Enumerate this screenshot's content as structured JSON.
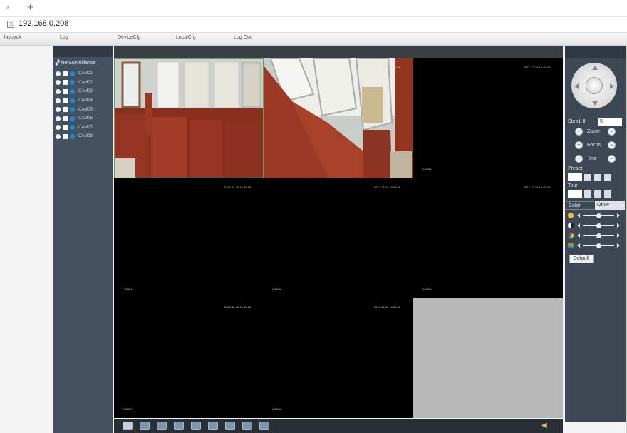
{
  "browser": {
    "tab_close": "×",
    "tab_new": "+",
    "url": "192.168.0.208"
  },
  "nav": {
    "items": [
      "layback",
      "Log",
      "DeviceCfg",
      "LocalCfg",
      "Log Out"
    ]
  },
  "sidebar": {
    "root": "NetSurveillance",
    "cameras": [
      "CAM01",
      "CAM02",
      "CAM03",
      "CAM04",
      "CAM05",
      "CAM06",
      "CAM07",
      "CAM08"
    ]
  },
  "video": {
    "cells": [
      {
        "timestamp": "",
        "channel": ""
      },
      {
        "timestamp": "2017-12-16 15:40:38",
        "channel": ""
      },
      {
        "timestamp": "2017-12-16 15:40:38",
        "channel": "CAM03"
      },
      {
        "timestamp": "2017-12-16 15:40:38",
        "channel": "CAM04"
      },
      {
        "timestamp": "2017-12-16 15:40:38",
        "channel": "CAM05"
      },
      {
        "timestamp": "2017-12-16 15:40:38",
        "channel": "CAM06"
      },
      {
        "timestamp": "2017-12-16 15:40:38",
        "channel": "CAM07"
      },
      {
        "timestamp": "2017-12-16 15:40:38",
        "channel": "CAM08"
      },
      {
        "timestamp": "",
        "channel": ""
      }
    ]
  },
  "ptz": {
    "step_label": "Step1-8:",
    "step_value": "5",
    "zoom_label": "Zoom",
    "focus_label": "Focus",
    "iris_label": "Iris",
    "preset_label": "Preset",
    "tour_label": "Tour",
    "tab_color": "Color",
    "tab_other": "Other",
    "default_label": "Default"
  },
  "colors": {
    "accent": "#1a8ad8",
    "panel": "#445160",
    "selected": "#5aa650"
  }
}
